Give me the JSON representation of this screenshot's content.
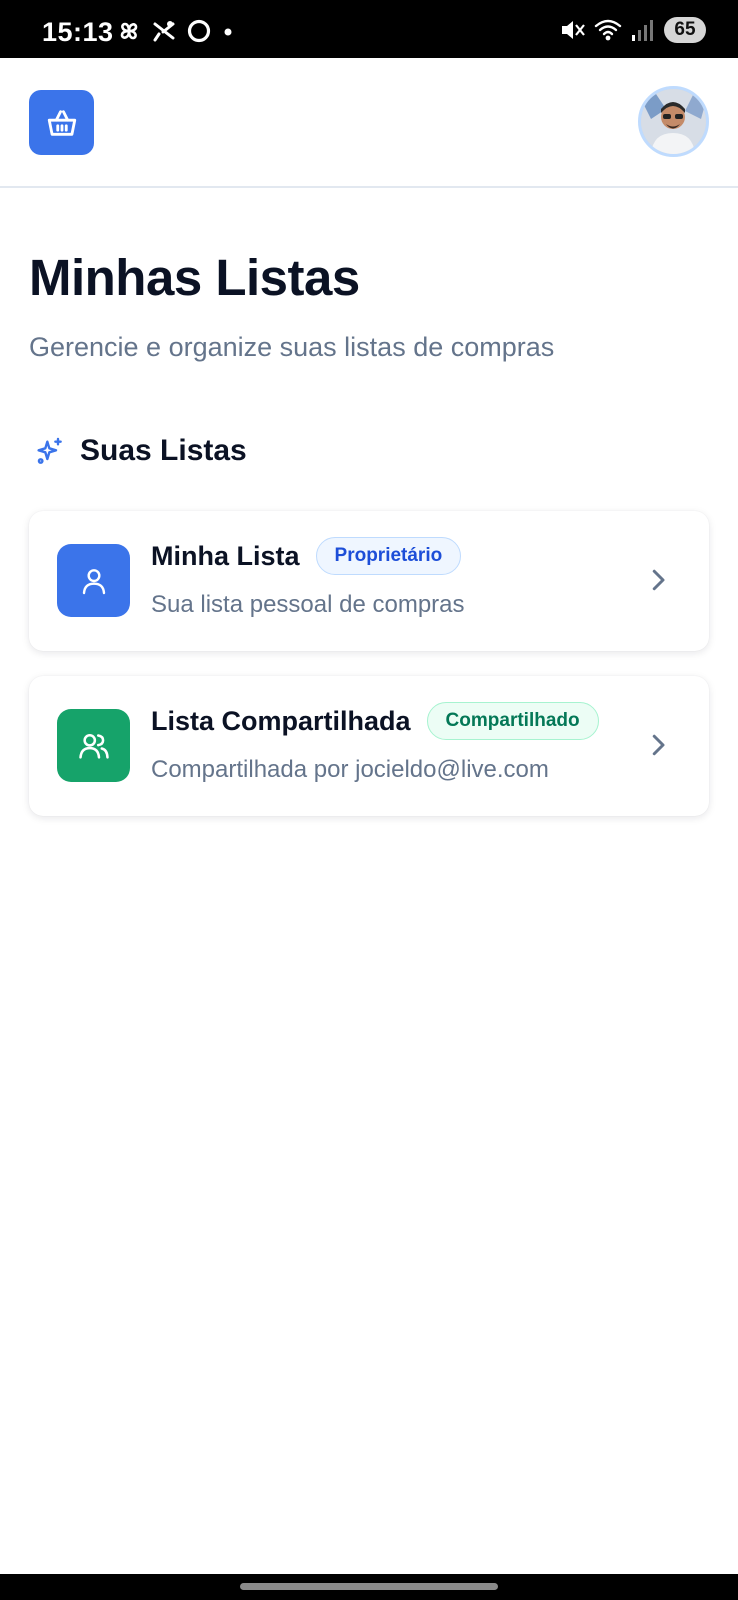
{
  "status_bar": {
    "time": "15:13",
    "battery": "65",
    "icons": [
      "pinwheel-icon",
      "scissors-icon",
      "circle-icon",
      "dot-icon",
      "mute-icon",
      "wifi-icon",
      "signal-icon"
    ]
  },
  "header": {
    "logo_icon": "basket-icon",
    "avatar": "user-avatar"
  },
  "page": {
    "title": "Minhas Listas",
    "subtitle": "Gerencie e organize suas listas de compras"
  },
  "section": {
    "icon": "sparkles-icon",
    "title": "Suas Listas"
  },
  "lists": [
    {
      "title": "Minha Lista",
      "badge": "Proprietário",
      "description": "Sua lista pessoal de compras",
      "icon": "user-icon",
      "icon_color": "#3b74ea",
      "badge_color": "#1d4ed8",
      "badge_bg": "#eff6ff",
      "badge_border": "#bfdbfe"
    },
    {
      "title": "Lista Compartilhada",
      "badge": "Compartilhado",
      "description": "Compartilhada por jocieldo@live.com",
      "icon": "users-icon",
      "icon_color": "#16a36a",
      "badge_color": "#047857",
      "badge_bg": "#ecfdf5",
      "badge_border": "#a7f3d0"
    }
  ]
}
